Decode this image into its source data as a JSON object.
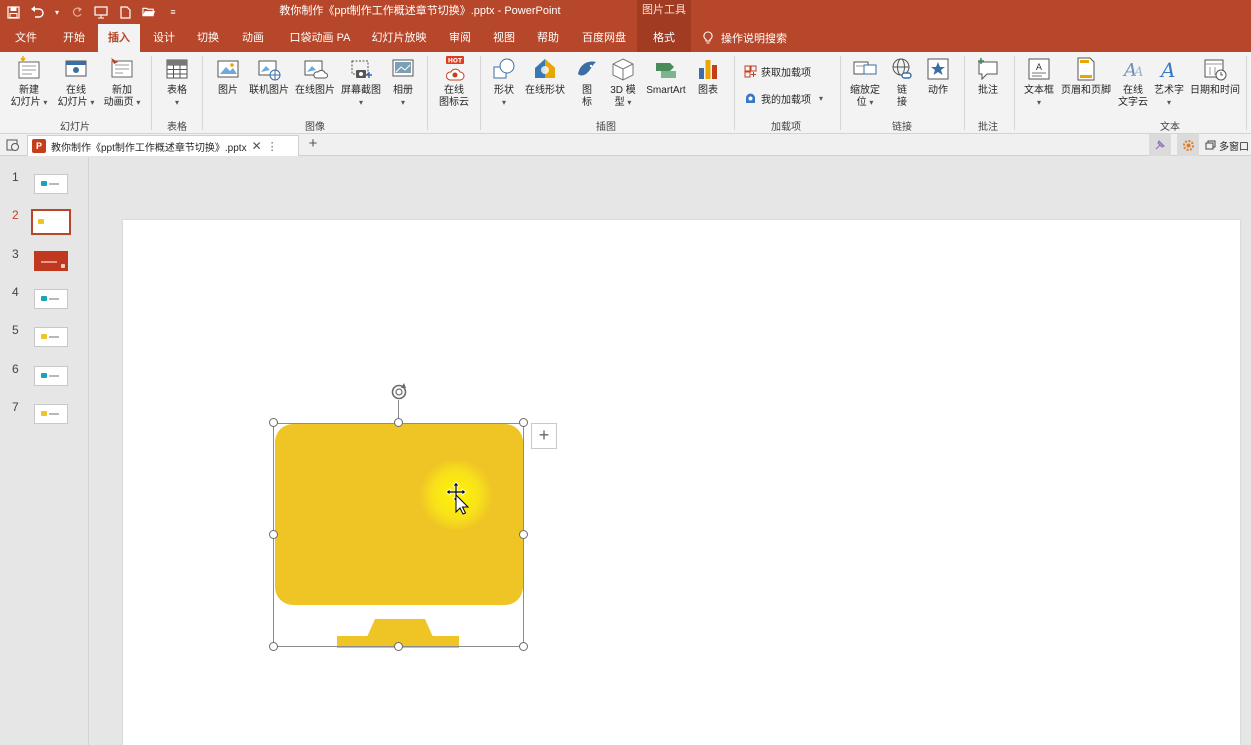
{
  "window": {
    "document_title": "教你制作《ppt制作工作概述章节切换》.pptx  -  PowerPoint",
    "context_tool_title": "图片工具"
  },
  "tabs": [
    {
      "label": "文件"
    },
    {
      "label": "开始"
    },
    {
      "label": "插入"
    },
    {
      "label": "设计"
    },
    {
      "label": "切换"
    },
    {
      "label": "动画"
    },
    {
      "label": "口袋动画 PA"
    },
    {
      "label": "幻灯片放映"
    },
    {
      "label": "审阅"
    },
    {
      "label": "视图"
    },
    {
      "label": "帮助"
    },
    {
      "label": "百度网盘"
    },
    {
      "label": "格式"
    }
  ],
  "tell_me": "操作说明搜索",
  "ribbon": {
    "groups": {
      "slides": "幻灯片",
      "tables": "表格",
      "images": "图像",
      "illustrations": "插图",
      "addins": "加载项",
      "links": "链接",
      "comments": "批注",
      "text": "文本"
    },
    "buttons": {
      "new_slide_1": "新建",
      "new_slide_2": "幻灯片",
      "online_slide_1": "在线",
      "online_slide_2": "幻灯片",
      "new_anim_page_1": "新加",
      "new_anim_page_2": "动画页",
      "table": "表格",
      "picture": "图片",
      "online_pic_lianji": "联机图片",
      "online_pic": "在线图片",
      "screenshot": "屏幕截图",
      "album": "相册",
      "icon_cloud_1": "在线",
      "icon_cloud_2": "图标云",
      "shapes": "形状",
      "online_shapes": "在线形状",
      "icons_1": "图",
      "icons_2": "标",
      "model3d_1": "3D 模",
      "model3d_2": "型",
      "smartart": "SmartArt",
      "chart": "图表",
      "get_addins": "获取加载项",
      "my_addins": "我的加载项",
      "zoom_1": "缩放定",
      "zoom_2": "位",
      "link_1": "链",
      "link_2": "接",
      "action": "动作",
      "comment": "批注",
      "textbox": "文本框",
      "header_footer": "页眉和页脚",
      "online_text_1": "在线",
      "online_text_2": "文字云",
      "wordart": "艺术字",
      "datetime": "日期和时间"
    },
    "hot_badge": "HOT"
  },
  "doc_tab": {
    "badge": "P",
    "name": "教你制作《ppt制作工作概述章节切换》.pptx",
    "multi_window": "多窗口"
  },
  "thumbnails": {
    "numbers": [
      "1",
      "2",
      "3",
      "4",
      "5",
      "6",
      "7"
    ],
    "active_index": 1
  },
  "colors": {
    "accent": "#b7472a",
    "monitor_yellow": "#efc525"
  }
}
